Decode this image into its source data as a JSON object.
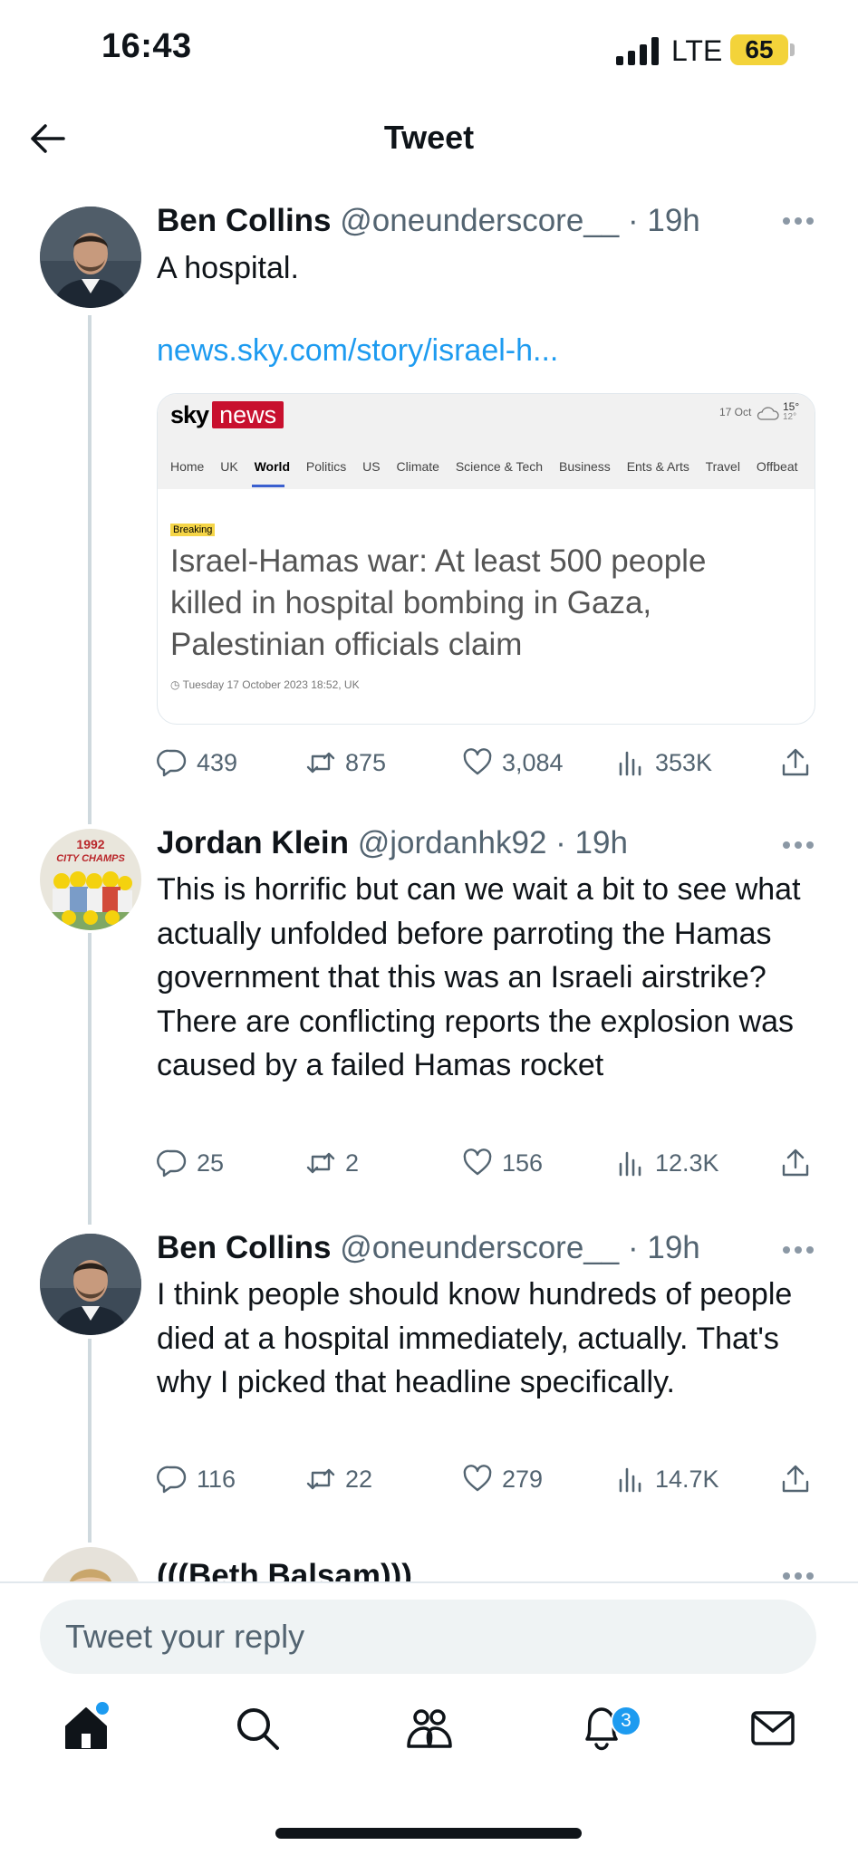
{
  "status_bar": {
    "time": "16:43",
    "network": "LTE",
    "battery": "65"
  },
  "header": {
    "title": "Tweet"
  },
  "tweets": [
    {
      "name": "Ben Collins",
      "handle": "@oneunderscore__",
      "time": "· 19h",
      "text": "A hospital.",
      "link": "news.sky.com/story/israel-h...",
      "card": {
        "logo_sky": "sky",
        "logo_news": "news",
        "weather_date": "17 Oct",
        "weather_high": "15°",
        "weather_low": "12°",
        "nav": [
          "Home",
          "UK",
          "World",
          "Politics",
          "US",
          "Climate",
          "Science & Tech",
          "Business",
          "Ents & Arts",
          "Travel",
          "Offbeat"
        ],
        "active_nav": "World",
        "badge": "Breaking",
        "headline": "Israel-Hamas war: At least 500 people killed in hospital bombing in Gaza, Palestinian officials claim",
        "date": "Tuesday 17 October 2023 18:52, UK"
      },
      "replies": "439",
      "retweets": "875",
      "likes": "3,084",
      "views": "353K"
    },
    {
      "name": "Jordan Klein",
      "handle": "@jordanhk92",
      "time": "· 19h",
      "avatar_text": [
        "1992",
        "CITY CHAMPS"
      ],
      "text": "This is horrific but can we wait a bit to see what actually unfolded before parroting the Hamas government that this was an Israeli airstrike?  There are conflicting reports the explosion was caused by a failed Hamas rocket",
      "replies": "25",
      "retweets": "2",
      "likes": "156",
      "views": "12.3K"
    },
    {
      "name": "Ben Collins",
      "handle": "@oneunderscore__",
      "time": "· 19h",
      "text": "I think people should know hundreds of people died at a hospital immediately, actually. That's why I picked that headline specifically.",
      "replies": "116",
      "retweets": "22",
      "likes": "279",
      "views": "14.7K"
    },
    {
      "name": "(((Beth Balsam)))"
    }
  ],
  "compose": {
    "placeholder": "Tweet your reply"
  },
  "tabbar": {
    "items": [
      "home-icon",
      "search-icon",
      "communities-icon",
      "bell-icon",
      "mail-icon"
    ],
    "notification_count": "3"
  },
  "colors": {
    "accent": "#1d9bf0",
    "muted": "#536471",
    "sky_red": "#c8102e",
    "breaking_yellow": "#f5d547"
  }
}
